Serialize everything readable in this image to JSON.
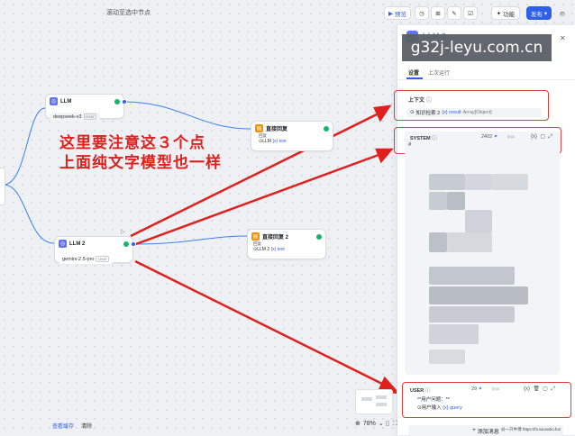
{
  "toolbar": {
    "hint": "滚动至选中节点",
    "preview": "预览",
    "features": "功能",
    "publish": "发布",
    "publish_caret": "▾"
  },
  "nodes": {
    "llm1": {
      "title": "LLM",
      "model": "deepseek-v3",
      "model_tag": "CHAT"
    },
    "reply1": {
      "title": "直接回复",
      "label": "回复",
      "var_source": "LLM",
      "var_name": "{x} text"
    },
    "llm2": {
      "title": "LLM 2",
      "model": "gemini-2.5-pro",
      "model_tag": "CHAT"
    },
    "reply2": {
      "title": "直接回复 2",
      "label": "回复",
      "var_source": "LLM 2",
      "var_name": "{x} text"
    }
  },
  "annotation": {
    "line1": "这里要注意这３个点",
    "line2": "上面纯文字模型也一样"
  },
  "panel": {
    "watermark": "g32j-leyu.com.cn",
    "node_title": "LLM 2",
    "tabs": [
      "设置",
      "上次运行"
    ],
    "context": {
      "label": "上下文",
      "source_node": "知识检索 2",
      "var": "{x} result",
      "var_type": "Array[Object]"
    },
    "system": {
      "label": "SYSTEM",
      "tokens": "2402",
      "mode": "jinja",
      "content": "#"
    },
    "user": {
      "label": "USER",
      "tokens": "29",
      "mode": "jinja",
      "line1": "**用户问题：**",
      "source_node": "用户输入",
      "var": "{x} query"
    },
    "add_message": "添加消息"
  },
  "bottom": {
    "view_cache": "查看缓存",
    "clear": "清除",
    "zoom": "78%",
    "credit": "@一只牛博 https://hi.aicowbo.fun"
  },
  "colors": {
    "accent": "#2f5ee9",
    "annotation_red": "#e0201c",
    "success": "#12b76a",
    "reply_orange": "#f79009"
  }
}
